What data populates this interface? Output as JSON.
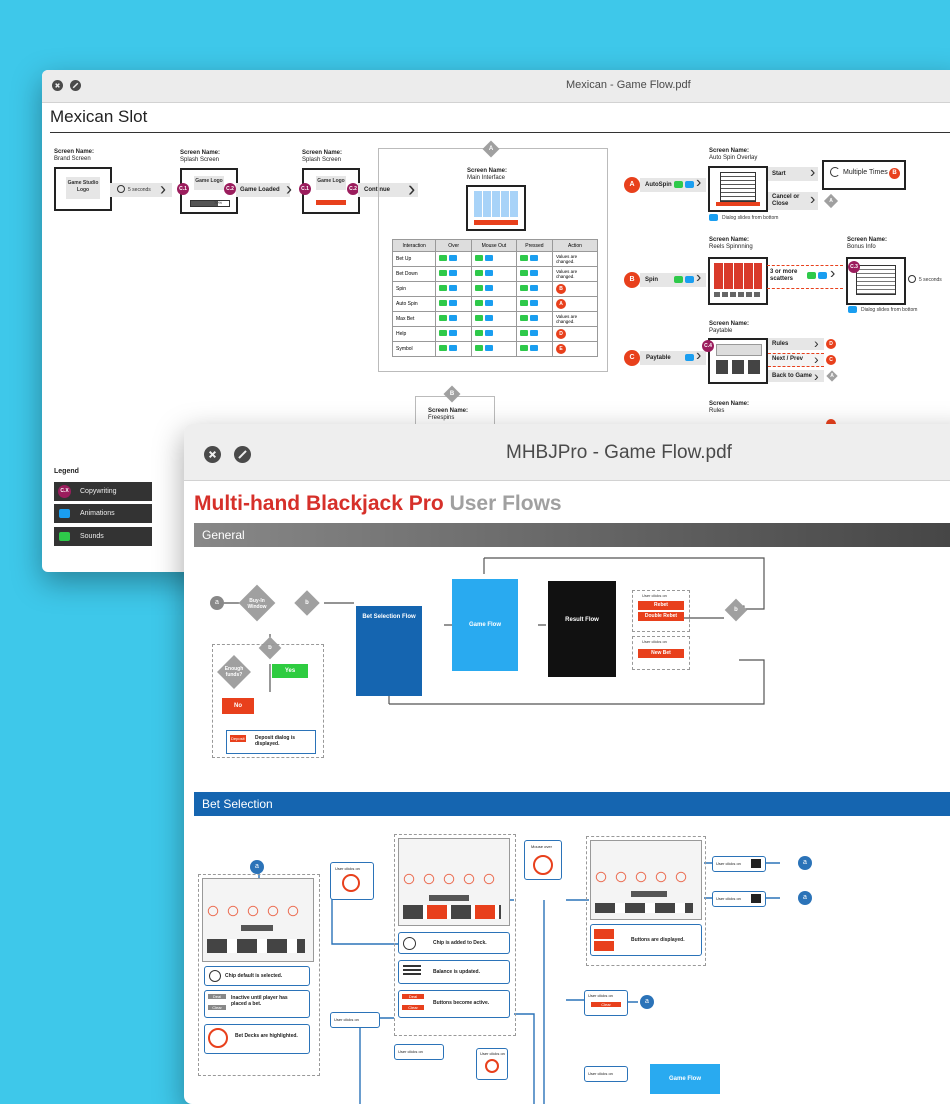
{
  "window1": {
    "title": "Mexican - Game Flow.pdf",
    "heading": "Mexican Slot",
    "screen_name_label": "Screen Name:",
    "brand_screen": "Brand Screen",
    "brand_logo": "Game Studio Logo",
    "five_seconds": "5 seconds",
    "splash1": "Splash Screen",
    "splash2": "Splash Screen",
    "game_logo": "Game Logo",
    "loading_pct": "70%",
    "game_loaded": "Game Loaded",
    "continue": "Continue",
    "main_interface": "Main Interface",
    "badge_c1": "C.1",
    "badge_c2": "C.2",
    "badge_c3": "C.3",
    "badge_c4": "C.4",
    "marker_a": "A",
    "marker_b": "B",
    "marker_c": "C",
    "marker_d": "D",
    "marker_e": "E",
    "table": {
      "headers": [
        "Interaction",
        "Over",
        "Mouse Out",
        "Pressed",
        "Action"
      ],
      "rows": [
        {
          "label": "Bet Up",
          "action": "Values are changed."
        },
        {
          "label": "Bet Down",
          "action": "Values are changed."
        },
        {
          "label": "Spin",
          "action": "B"
        },
        {
          "label": "Auto Spin",
          "action": "A"
        },
        {
          "label": "Max Bet",
          "action": "Values are changed."
        },
        {
          "label": "Help",
          "action": "D"
        },
        {
          "label": "Symbol",
          "action": "E"
        }
      ]
    },
    "freespins": "Freespins",
    "autospin_overlay": "Auto Spin Overlay",
    "autospin": "AutoSpin",
    "start": "Start",
    "multiple_times": "Multiple Times",
    "cancel_close": "Cancel or Close",
    "dialog_slides": "Dialog slides from bottom",
    "reels_spinning": "Reels Spinnning",
    "spin": "Spin",
    "three_scatters": "3 or more scatters",
    "bonus_info": "Bonus Info",
    "paytable_screen": "Paytable",
    "paytable": "Paytable",
    "rules_link": "Rules",
    "next_prev": "Next / Prev",
    "back_to_game": "Back to Game",
    "rules_screen": "Rules",
    "legend": {
      "title": "Legend",
      "items": [
        {
          "badge": "C.X",
          "label": "Copywriting",
          "color": "#9b1d5d"
        },
        {
          "badge": "",
          "label": "Animations",
          "color": "#1a9ef0"
        },
        {
          "badge": "",
          "label": "Sounds",
          "color": "#2ec94a"
        }
      ]
    }
  },
  "window2": {
    "title": "MHBJPro - Game Flow.pdf",
    "heading_bold": "Multi-hand Blackjack Pro",
    "heading_light": "User Flows",
    "section_general": "General",
    "section_bet": "Bet Selection",
    "a": "a",
    "b": "b",
    "buy_in": "Buy-In Window",
    "enough_funds": "Enough funds?",
    "yes": "Yes",
    "no": "No",
    "deposit": "Deposit",
    "deposit_msg": "Deposit dialog is displayed.",
    "bet_selection_flow": "Bet Selection Flow",
    "game_flow": "Game Flow",
    "result_flow": "Result Flow",
    "user_clicks_on": "User clicks on",
    "rebet": "Rebet",
    "double_rebet": "Double Rebet",
    "new_bet": "New Bet",
    "chip_default": "Chip default is selected.",
    "inactive_until": "Inactive until player has placed a bet.",
    "deal": "Deal",
    "clear": "Clear",
    "bet_decks": "Bet Decks are highlighted.",
    "chip_added": "Chip is added to Deck.",
    "balance_updated": "Balance is updated.",
    "buttons_active": "Buttons become active.",
    "mouse_over": "Mouse over",
    "buttons_displayed": "Buttons are displayed.",
    "colors": {
      "blue_dark": "#1565b0",
      "blue_light": "#29aaf0",
      "black": "#111111",
      "red": "#e8401c",
      "green": "#2ecc40"
    }
  }
}
